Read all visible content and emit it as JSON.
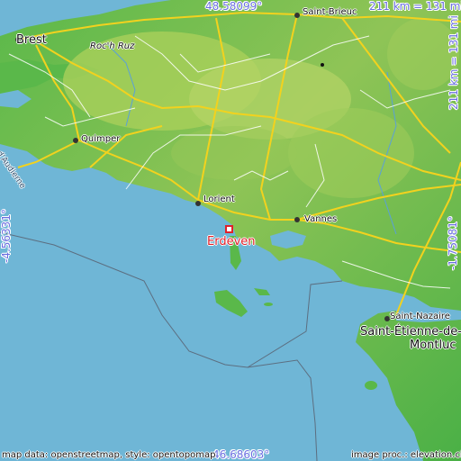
{
  "map": {
    "target_city": "Erdeven",
    "coordinates": {
      "top_lat": "48.58099°",
      "bottom_lat": "46.68603°",
      "left_lon": "-4.56331°",
      "right_lon": "-1.75081°"
    },
    "scale": {
      "horizontal": "211 km = 131 mi",
      "vertical": "211 km = 131 mi"
    },
    "cities": {
      "brest": "Brest",
      "saint_brieuc": "Saint-Brieuc",
      "roc_h_ruz": "Roc'h Ruz",
      "quimper": "Quimper",
      "lorient": "Lorient",
      "vannes": "Vannes",
      "saint_nazaire": "Saint-Nazaire",
      "saint_etienne_1": "Saint-Étienne-de-",
      "saint_etienne_2": "Montluc",
      "audierne": "d'Audierne"
    },
    "attribution": {
      "left": "map data: openstreetmap, style: opentopomap",
      "right": "image proc.: elevation.city"
    },
    "colors": {
      "sea": "#6fb6d6",
      "land_low": "#52b84a",
      "land_high": "#a9cf5a",
      "road": "#f2d21e",
      "marker": "#e0202a"
    }
  }
}
